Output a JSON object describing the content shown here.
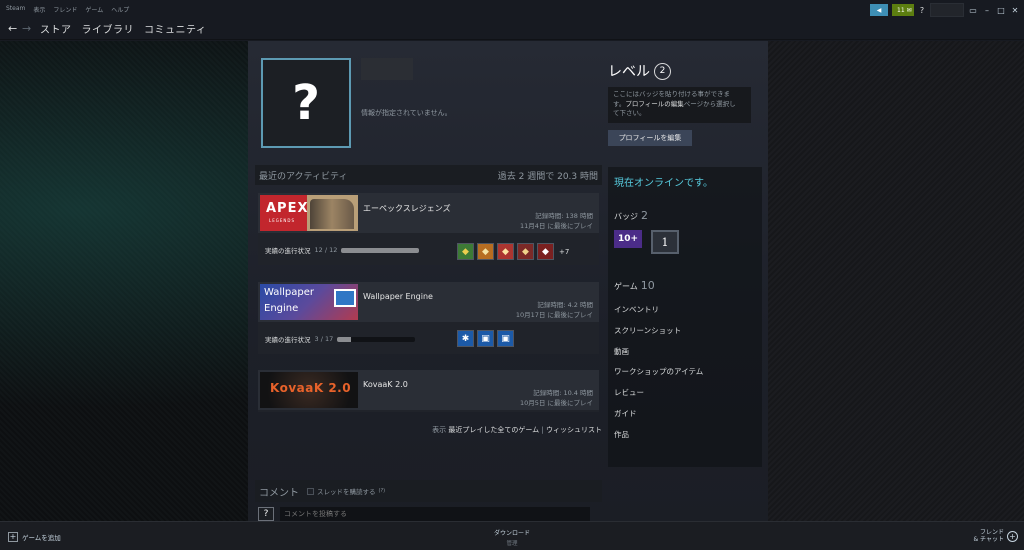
{
  "menu": [
    "Steam",
    "表示",
    "フレンド",
    "ゲーム",
    "ヘルプ"
  ],
  "titlebar": {
    "mail_count": "11",
    "help": "?"
  },
  "nav": {
    "back": "←",
    "forward": "→",
    "links": [
      "ストア",
      "ライブラリ",
      "コミュニティ"
    ]
  },
  "profile": {
    "avatar_glyph": "?",
    "info": "情報が指定されていません。",
    "level_label": "レベル",
    "level": "2",
    "badge_hint_1": "ここにはバッジを貼り付ける事ができま",
    "badge_hint_2a": "す。",
    "badge_hint_2b": "プロフィールの編集",
    "badge_hint_2c": "ページから選択し",
    "badge_hint_3": "て下さい。",
    "edit_button": "プロフィールを編集"
  },
  "activity": {
    "title": "最近のアクティビティ",
    "summary": "過去 2 週間で 20.3 時間",
    "games": [
      {
        "name": "エーペックスレジェンズ",
        "thumb_text": "APEX",
        "thumb_sub": "LEGENDS",
        "hours": "記録時間: 138 時間",
        "last": "11月4日 に最後にプレイ",
        "ach_label": "実績の進行状況",
        "ach_count": "12 / 12",
        "ach_progress": 1.0,
        "ach_more": "+7"
      },
      {
        "name": "Wallpaper Engine",
        "thumb_text_1": "Wallpaper",
        "thumb_text_2": "Engine",
        "hours": "記録時間: 4.2 時間",
        "last": "10月17日 に最後にプレイ",
        "ach_label": "実績の進行状況",
        "ach_count": "3 / 17",
        "ach_progress": 0.18
      },
      {
        "name": "KovaaK 2.0",
        "thumb_text": "KovaaK 2.0",
        "hours": "記録時間: 10.4 時間",
        "last": "10月5日 に最後にプレイ"
      }
    ],
    "view_prefix": "表示",
    "view_recent": "最近プレイした全てのゲーム",
    "view_sep": "|",
    "view_wishlist": "ウィッシュリスト"
  },
  "comments": {
    "title": "コメント",
    "subscribe": "スレッドを購読する",
    "subscribe_sup": "(?)",
    "placeholder": "コメントを投稿する",
    "avatar_glyph": "?"
  },
  "sidebar": {
    "status": "現在オンラインです。",
    "badges_label": "バッジ",
    "badges_count": "2",
    "badge_1": "10+",
    "badge_2": "1",
    "games_label": "ゲーム",
    "games_count": "10",
    "links": [
      "インベントリ",
      "スクリーンショット",
      "動画",
      "ワークショップのアイテム",
      "レビュー",
      "ガイド",
      "作品"
    ]
  },
  "bottom": {
    "add_game": "ゲームを追加",
    "downloads": "ダウンロード",
    "downloads_sub": "管理",
    "friends_1": "フレンド",
    "friends_2": "& チャット"
  },
  "colors": {
    "accent": "#57cbde",
    "bg": "#171a21"
  }
}
